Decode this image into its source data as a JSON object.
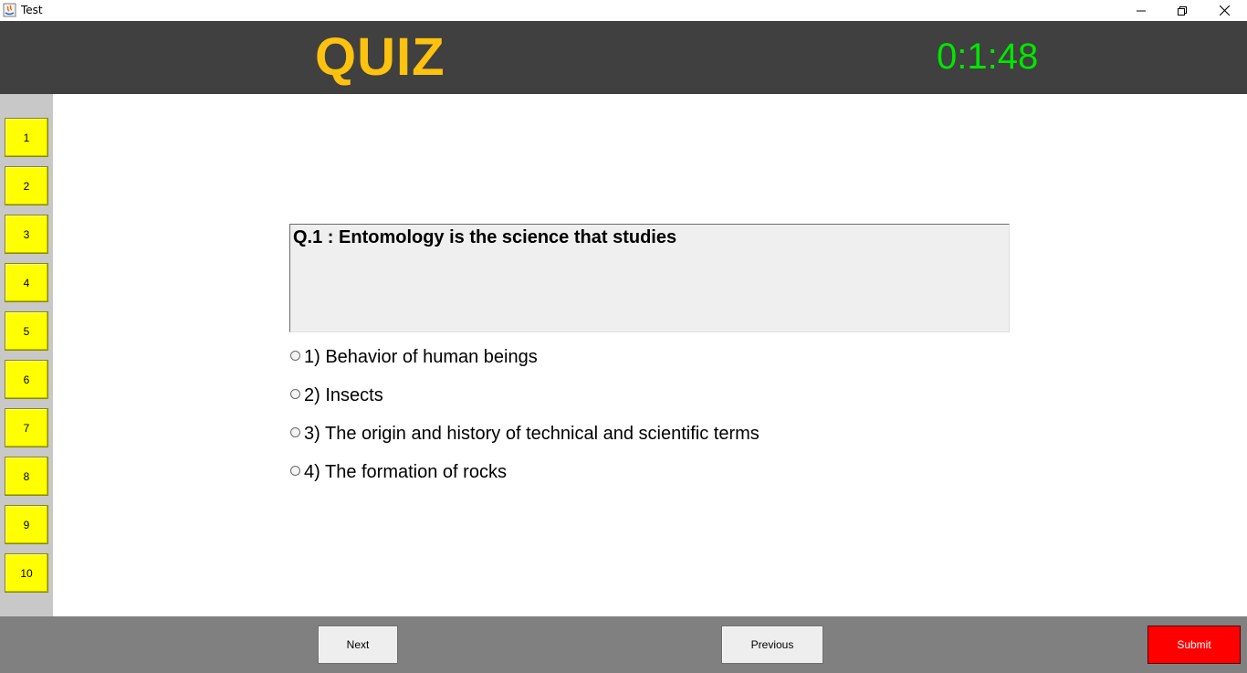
{
  "window": {
    "title": "Test",
    "icon": "java-icon",
    "controls": [
      "minimize-icon",
      "maximize-icon",
      "close-icon"
    ]
  },
  "header": {
    "title": "QUIZ",
    "timer": "0:1:48",
    "title_color": "#ffc20e",
    "timer_color": "#00e600"
  },
  "sidebar": {
    "question_numbers": [
      "1",
      "2",
      "3",
      "4",
      "5",
      "6",
      "7",
      "8",
      "9",
      "10"
    ],
    "button_color": "#ffff00"
  },
  "question": {
    "text": "Q.1 : Entomology is the science that studies",
    "options": [
      "1) Behavior of human beings",
      "2) Insects",
      "3) The origin and history of technical and scientific terms",
      "4) The formation of rocks"
    ]
  },
  "footer": {
    "next_label": "Next",
    "previous_label": "Previous",
    "submit_label": "Submit",
    "submit_color": "#ff0000"
  }
}
